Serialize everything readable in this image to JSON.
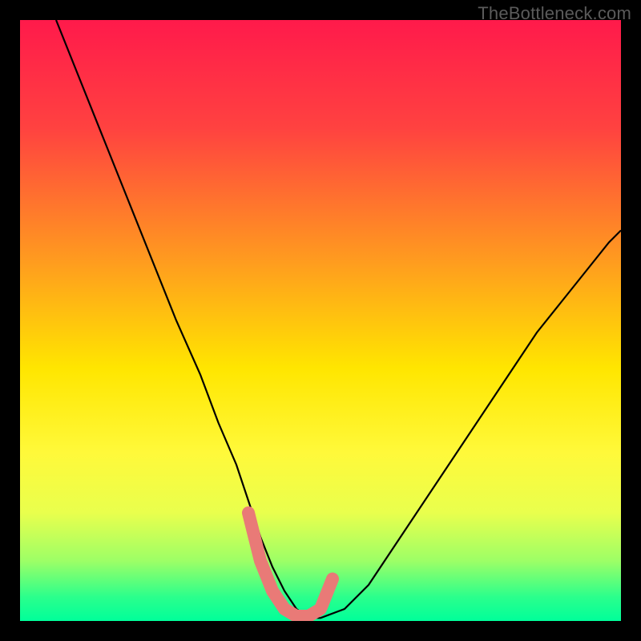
{
  "watermark": "TheBottleneck.com",
  "chart_data": {
    "type": "line",
    "title": "",
    "xlabel": "",
    "ylabel": "",
    "xlim": [
      0,
      100
    ],
    "ylim": [
      0,
      100
    ],
    "gradient_stops": [
      {
        "offset": 0,
        "color": "#ff1a4b"
      },
      {
        "offset": 0.18,
        "color": "#ff4240"
      },
      {
        "offset": 0.4,
        "color": "#ff9b1f"
      },
      {
        "offset": 0.58,
        "color": "#ffe600"
      },
      {
        "offset": 0.72,
        "color": "#fff93a"
      },
      {
        "offset": 0.82,
        "color": "#e9ff4d"
      },
      {
        "offset": 0.9,
        "color": "#9dff66"
      },
      {
        "offset": 0.96,
        "color": "#2bff8c"
      },
      {
        "offset": 1.0,
        "color": "#00ff9a"
      }
    ],
    "series": [
      {
        "name": "bottleneck-curve",
        "x": [
          6,
          10,
          14,
          18,
          22,
          26,
          30,
          33,
          36,
          38,
          40,
          42,
          44,
          46,
          48,
          50,
          54,
          58,
          62,
          66,
          70,
          74,
          78,
          82,
          86,
          90,
          94,
          98,
          100
        ],
        "y": [
          100,
          90,
          80,
          70,
          60,
          50,
          41,
          33,
          26,
          20,
          14,
          9,
          5,
          2,
          0.5,
          0.5,
          2,
          6,
          12,
          18,
          24,
          30,
          36,
          42,
          48,
          53,
          58,
          63,
          65
        ]
      }
    ],
    "highlight": {
      "name": "optimal-range",
      "color": "#e97a77",
      "x": [
        38,
        40,
        42,
        44,
        46,
        48,
        50,
        52
      ],
      "y": [
        18,
        10,
        5,
        2,
        0.8,
        0.8,
        2,
        7
      ]
    }
  }
}
